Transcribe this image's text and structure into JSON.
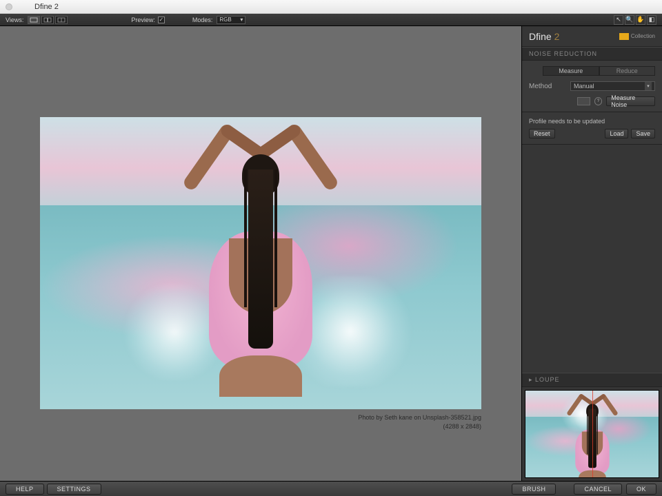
{
  "window": {
    "title": "Dfine 2"
  },
  "toolbar": {
    "views_label": "Views:",
    "preview_label": "Preview:",
    "modes_label": "Modes:",
    "mode_value": "RGB"
  },
  "canvas": {
    "caption_line1": "Photo by Seth kane on Unsplash-358521.jpg",
    "caption_line2": "(4288 x 2848)"
  },
  "panel": {
    "title_main": "Dfine ",
    "title_ver": "2",
    "brand_text": "Collection",
    "noise_section": "NOISE REDUCTION",
    "tab_measure": "Measure",
    "tab_reduce": "Reduce",
    "method_label": "Method",
    "method_value": "Manual",
    "measure_noise": "Measure Noise",
    "profile_msg": "Profile needs to be updated",
    "reset": "Reset",
    "load": "Load",
    "save": "Save",
    "loupe": "LOUPE"
  },
  "bottom": {
    "help": "HELP",
    "settings": "SETTINGS",
    "brush": "BRUSH",
    "cancel": "CANCEL",
    "ok": "OK"
  }
}
